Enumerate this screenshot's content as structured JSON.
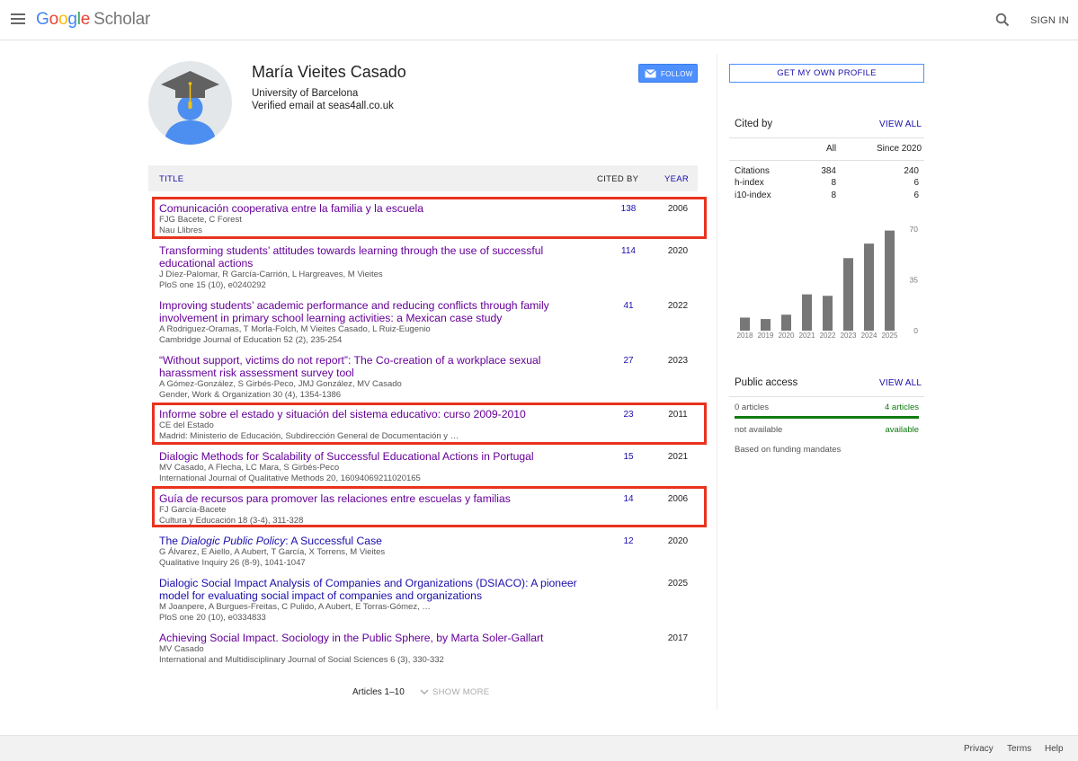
{
  "header": {
    "logo_google": [
      "G",
      "o",
      "o",
      "g",
      "l",
      "e"
    ],
    "logo_scholar": "Scholar",
    "signin_label": "SIGN IN"
  },
  "profile": {
    "name": "María Vieites Casado",
    "affiliation": "University of Barcelona",
    "email": "Verified email at seas4all.co.uk",
    "follow_label": "FOLLOW"
  },
  "table": {
    "col_title": "TITLE",
    "col_cited": "CITED BY",
    "col_year": "YEAR",
    "articles": [
      {
        "title": "Comunicación cooperativa entre la familia y la escuela",
        "authors": "FJG Bacete, C Forest",
        "venue": "Nau Llibres",
        "cited": "138",
        "year": "2006",
        "highlighted": true
      },
      {
        "title": "Transforming students’ attitudes towards learning through the use of successful educational actions",
        "authors": "J Díez-Palomar, R García-Carrión, L Hargreaves, M Vieites",
        "venue": "PloS one 15 (10), e0240292",
        "cited": "114",
        "year": "2020",
        "highlighted": false
      },
      {
        "title": "Improving students’ academic performance and reducing conflicts through family involvement in primary school learning activities: a Mexican case study",
        "authors": "A Rodriguez-Oramas, T Morla-Folch, M Vieites Casado, L Ruiz-Eugenio",
        "venue": "Cambridge Journal of Education 52 (2), 235-254",
        "cited": "41",
        "year": "2022",
        "highlighted": false
      },
      {
        "title": "“Without support, victims do not report”: The Co-creation of a workplace sexual harassment risk assessment survey tool",
        "authors": "A Gómez-González, S Girbés-Peco, JMJ González, MV Casado",
        "venue": "Gender, Work & Organization 30 (4), 1354-1386",
        "cited": "27",
        "year": "2023",
        "highlighted": false
      },
      {
        "title": "Informe sobre el estado y situación del sistema educativo: curso 2009-2010",
        "authors": "CE del Estado",
        "venue": "Madrid: Ministerio de Educación, Subdirección General de Documentación y …",
        "cited": "23",
        "year": "2011",
        "highlighted": true
      },
      {
        "title": "Dialogic Methods for Scalability of Successful Educational Actions in Portugal",
        "authors": "MV Casado, A Flecha, LC Mara, S Girbés-Peco",
        "venue": "International Journal of Qualitative Methods 20, 16094069211020165",
        "cited": "15",
        "year": "2021",
        "highlighted": false
      },
      {
        "title": "Guía de recursos para promover las relaciones entre escuelas y familias",
        "authors": "FJ García-Bacete",
        "venue": "Cultura y Educación 18 (3-4), 311-328",
        "cited": "14",
        "year": "2006",
        "highlighted": true
      },
      {
        "title_parts": [
          "The ",
          "Dialogic Public Policy",
          ": A Successful Case"
        ],
        "authors": "G Álvarez, E Aiello, A Aubert, T García, X Torrens, M Vieites",
        "venue": "Qualitative Inquiry 26 (8-9), 1041-1047",
        "cited": "12",
        "year": "2020",
        "highlighted": false
      },
      {
        "title": "Dialogic Social Impact Analysis of Companies and Organizations (DSIACO): A pioneer model for evaluating social impact of companies and organizations",
        "authors": "M Joanpere, A Burgues-Freitas, C Pulido, A Aubert, E Torras-Gómez, …",
        "venue": "PloS one 20 (10), e0334833",
        "cited": "",
        "year": "2025",
        "highlighted": false
      },
      {
        "title": "Achieving Social Impact. Sociology in the Public Sphere, by Marta Soler-Gallart",
        "authors": "MV Casado",
        "venue": "International and Multidisciplinary Journal of Social Sciences 6 (3), 330-332",
        "cited": "",
        "year": "2017",
        "highlighted": false
      }
    ],
    "articles_count": "Articles 1–10",
    "show_more": "SHOW MORE"
  },
  "sidebar": {
    "get_profile": "GET MY OWN PROFILE",
    "cited_by": {
      "title": "Cited by",
      "view_all": "VIEW ALL",
      "col_all": "All",
      "col_since": "Since 2020",
      "rows": [
        {
          "label": "Citations",
          "all": "384",
          "since": "240"
        },
        {
          "label": "h-index",
          "all": "8",
          "since": "6"
        },
        {
          "label": "i10-index",
          "all": "8",
          "since": "6"
        }
      ]
    },
    "chart_data": {
      "type": "bar",
      "categories": [
        "2018",
        "2019",
        "2020",
        "2021",
        "2022",
        "2023",
        "2024",
        "2025"
      ],
      "values": [
        9,
        8,
        11,
        25,
        24,
        50,
        60,
        69
      ],
      "yticks": [
        "70",
        "35",
        "0"
      ],
      "ylim": [
        0,
        70
      ],
      "bar_color": "#777777"
    },
    "public_access": {
      "title": "Public access",
      "view_all": "VIEW ALL",
      "not_avail_label": "0 articles",
      "avail_label": "4 articles",
      "not_avail_status": "not available",
      "avail_status": "available",
      "avail_fraction": 1.0,
      "note": "Based on funding mandates",
      "bar_color": "#0f7b0f"
    }
  },
  "footer": {
    "privacy": "Privacy",
    "terms": "Terms",
    "help": "Help"
  }
}
